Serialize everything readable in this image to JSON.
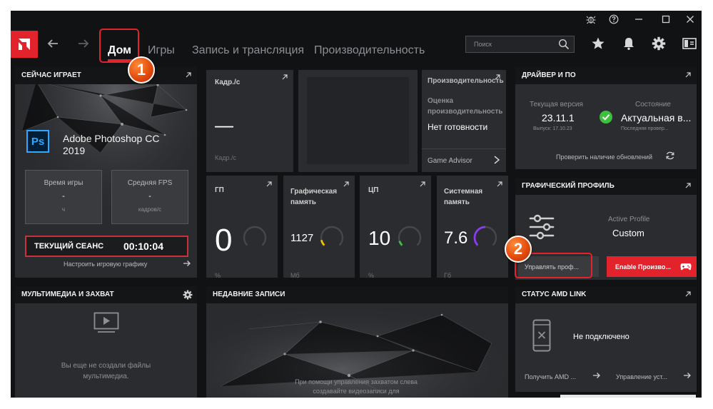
{
  "nav": {
    "tabs": [
      {
        "label": "Дом"
      },
      {
        "label": "Игры"
      },
      {
        "label": "Запись и трансляция"
      },
      {
        "label": "Производительность"
      }
    ],
    "search_placeholder": "Поиск"
  },
  "now_playing": {
    "title": "СЕЙЧАС ИГРАЕТ",
    "app_icon_text": "Ps",
    "app_name": "Adobe Photoshop CC 2019",
    "play_time_label": "Время игры",
    "play_time_value": "-",
    "play_time_unit": "ч",
    "avg_fps_label": "Средняя FPS",
    "avg_fps_value": "-",
    "avg_fps_unit": "кадров/с",
    "session_label": "ТЕКУЩИЙ СЕАНС",
    "session_value": "00:10:04",
    "settings_link": "Настроить игровую графику"
  },
  "fps_panel": {
    "title": "Кадр./с",
    "value": "—",
    "unit": "Кадр./с"
  },
  "perf_panel": {
    "title": "Производительность",
    "rating_label": "Оценка производительность",
    "rating_value": "Нет готовности",
    "advisor_link": "Game Advisor"
  },
  "driver": {
    "title": "ДРАЙВЕР И ПО",
    "current_label": "Текущая версия",
    "current_value": "23.11.1",
    "release_label": "Выпуск: 17.10.23",
    "status_label": "Состояние",
    "status_value": "Актуальная в...",
    "last_check": "Последняя провер...",
    "check_updates": "Проверить наличие обновлений"
  },
  "metrics": [
    {
      "title": "ГП",
      "value": "0",
      "unit": "%",
      "level": 0.0,
      "color": "#8d8f94"
    },
    {
      "title": "Графическая память",
      "value": "1127",
      "unit": "Мб",
      "level": 0.12,
      "color": "#f2c200"
    },
    {
      "title": "ЦП",
      "value": "10",
      "unit": "%",
      "level": 0.1,
      "color": "#3fbf3f"
    },
    {
      "title": "Системная память",
      "value": "7.6",
      "unit": "Гб",
      "level": 0.5,
      "color": "#8a3df0"
    }
  ],
  "graphics_profile": {
    "title": "ГРАФИЧЕСКИЙ ПРОФИЛЬ",
    "active_label": "Active Profile",
    "active_value": "Custom",
    "manage_button": "Управлять проф...",
    "enable_button": "Enable Произво..."
  },
  "media": {
    "title": "МУЛЬТИМЕДИА И ЗАХВАТ",
    "empty_text": "Вы еще не создали файлы мультимедиа."
  },
  "recent": {
    "title": "НЕДАВНИЕ ЗАПИСИ",
    "hint": "При помощи управления захватом слева создавайте видеозаписи для"
  },
  "amd_link": {
    "title": "СТАТУС AMD LINK",
    "status": "Не подключено",
    "get_link": "Получить AMD ...",
    "manage_devices": "Управление уст..."
  },
  "annotations": {
    "step1": "1",
    "step2": "2"
  },
  "colors": {
    "accent_red": "#e2232b",
    "background": "#111214",
    "panel": "#2b2c2f",
    "ok_green": "#3fbf3f",
    "ps_blue": "#31a8ff"
  }
}
